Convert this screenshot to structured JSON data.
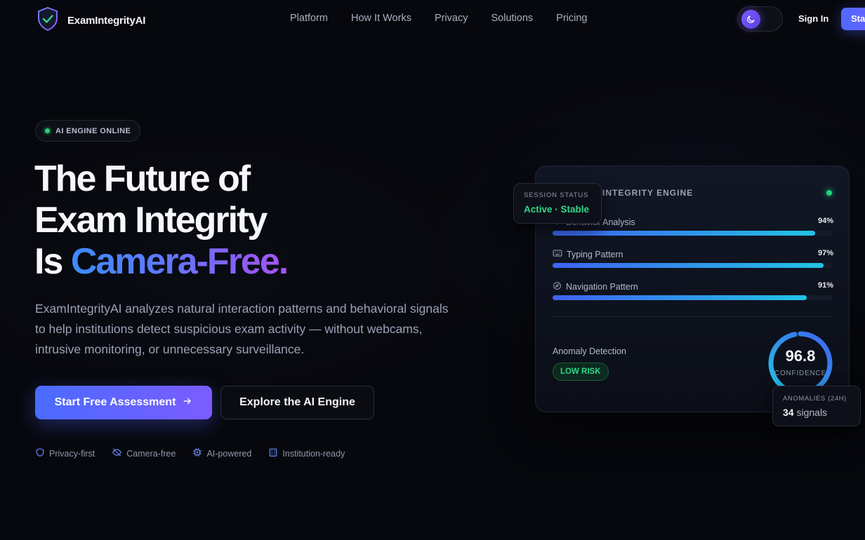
{
  "brand": {
    "name": "ExamIntegrityAI"
  },
  "nav": {
    "links": [
      "Platform",
      "How It Works",
      "Privacy",
      "Solutions",
      "Pricing"
    ],
    "sign_in": "Sign In",
    "start": "Start Free Assessment"
  },
  "hero": {
    "badge": "AI ENGINE ONLINE",
    "headline_line1": "The Future of",
    "headline_line2": "Exam Integrity",
    "headline_is": "Is",
    "headline_accent": "Camera-Free.",
    "subtext": "ExamIntegrityAI analyzes natural interaction patterns and behavioral signals to help institutions detect suspicious exam activity — without webcams, intrusive monitoring, or unnecessary surveillance.",
    "primary_cta": "Start Free Assessment",
    "secondary_cta": "Explore the AI Engine",
    "features": [
      "Privacy-first",
      "Camera-free",
      "AI-powered",
      "Institution-ready"
    ]
  },
  "engine_card": {
    "title": "INTEGRITY ENGINE",
    "metrics": [
      {
        "label": "Behavior Analysis",
        "value": "94%",
        "fraction": 0.94,
        "icon": "behavior-icon"
      },
      {
        "label": "Typing Pattern",
        "value": "97%",
        "fraction": 0.97,
        "icon": "keyboard-icon"
      },
      {
        "label": "Navigation Pattern",
        "value": "91%",
        "fraction": 0.91,
        "icon": "compass-icon"
      }
    ],
    "anomaly_label": "Anomaly Detection",
    "risk": "LOW RISK",
    "confidence_value": "96.8",
    "confidence_fraction": 0.968,
    "confidence_label": "CONFIDENCE"
  },
  "session_status": {
    "label": "SESSION STATUS",
    "value": "Active · Stable"
  },
  "anomalies": {
    "label": "ANOMALIES (24H)",
    "count": "34",
    "unit": "signals"
  },
  "colors": {
    "accent": "#4f6bff",
    "accent_purple": "#8d5cf6",
    "success": "#22d37a",
    "background": "#07080d"
  }
}
